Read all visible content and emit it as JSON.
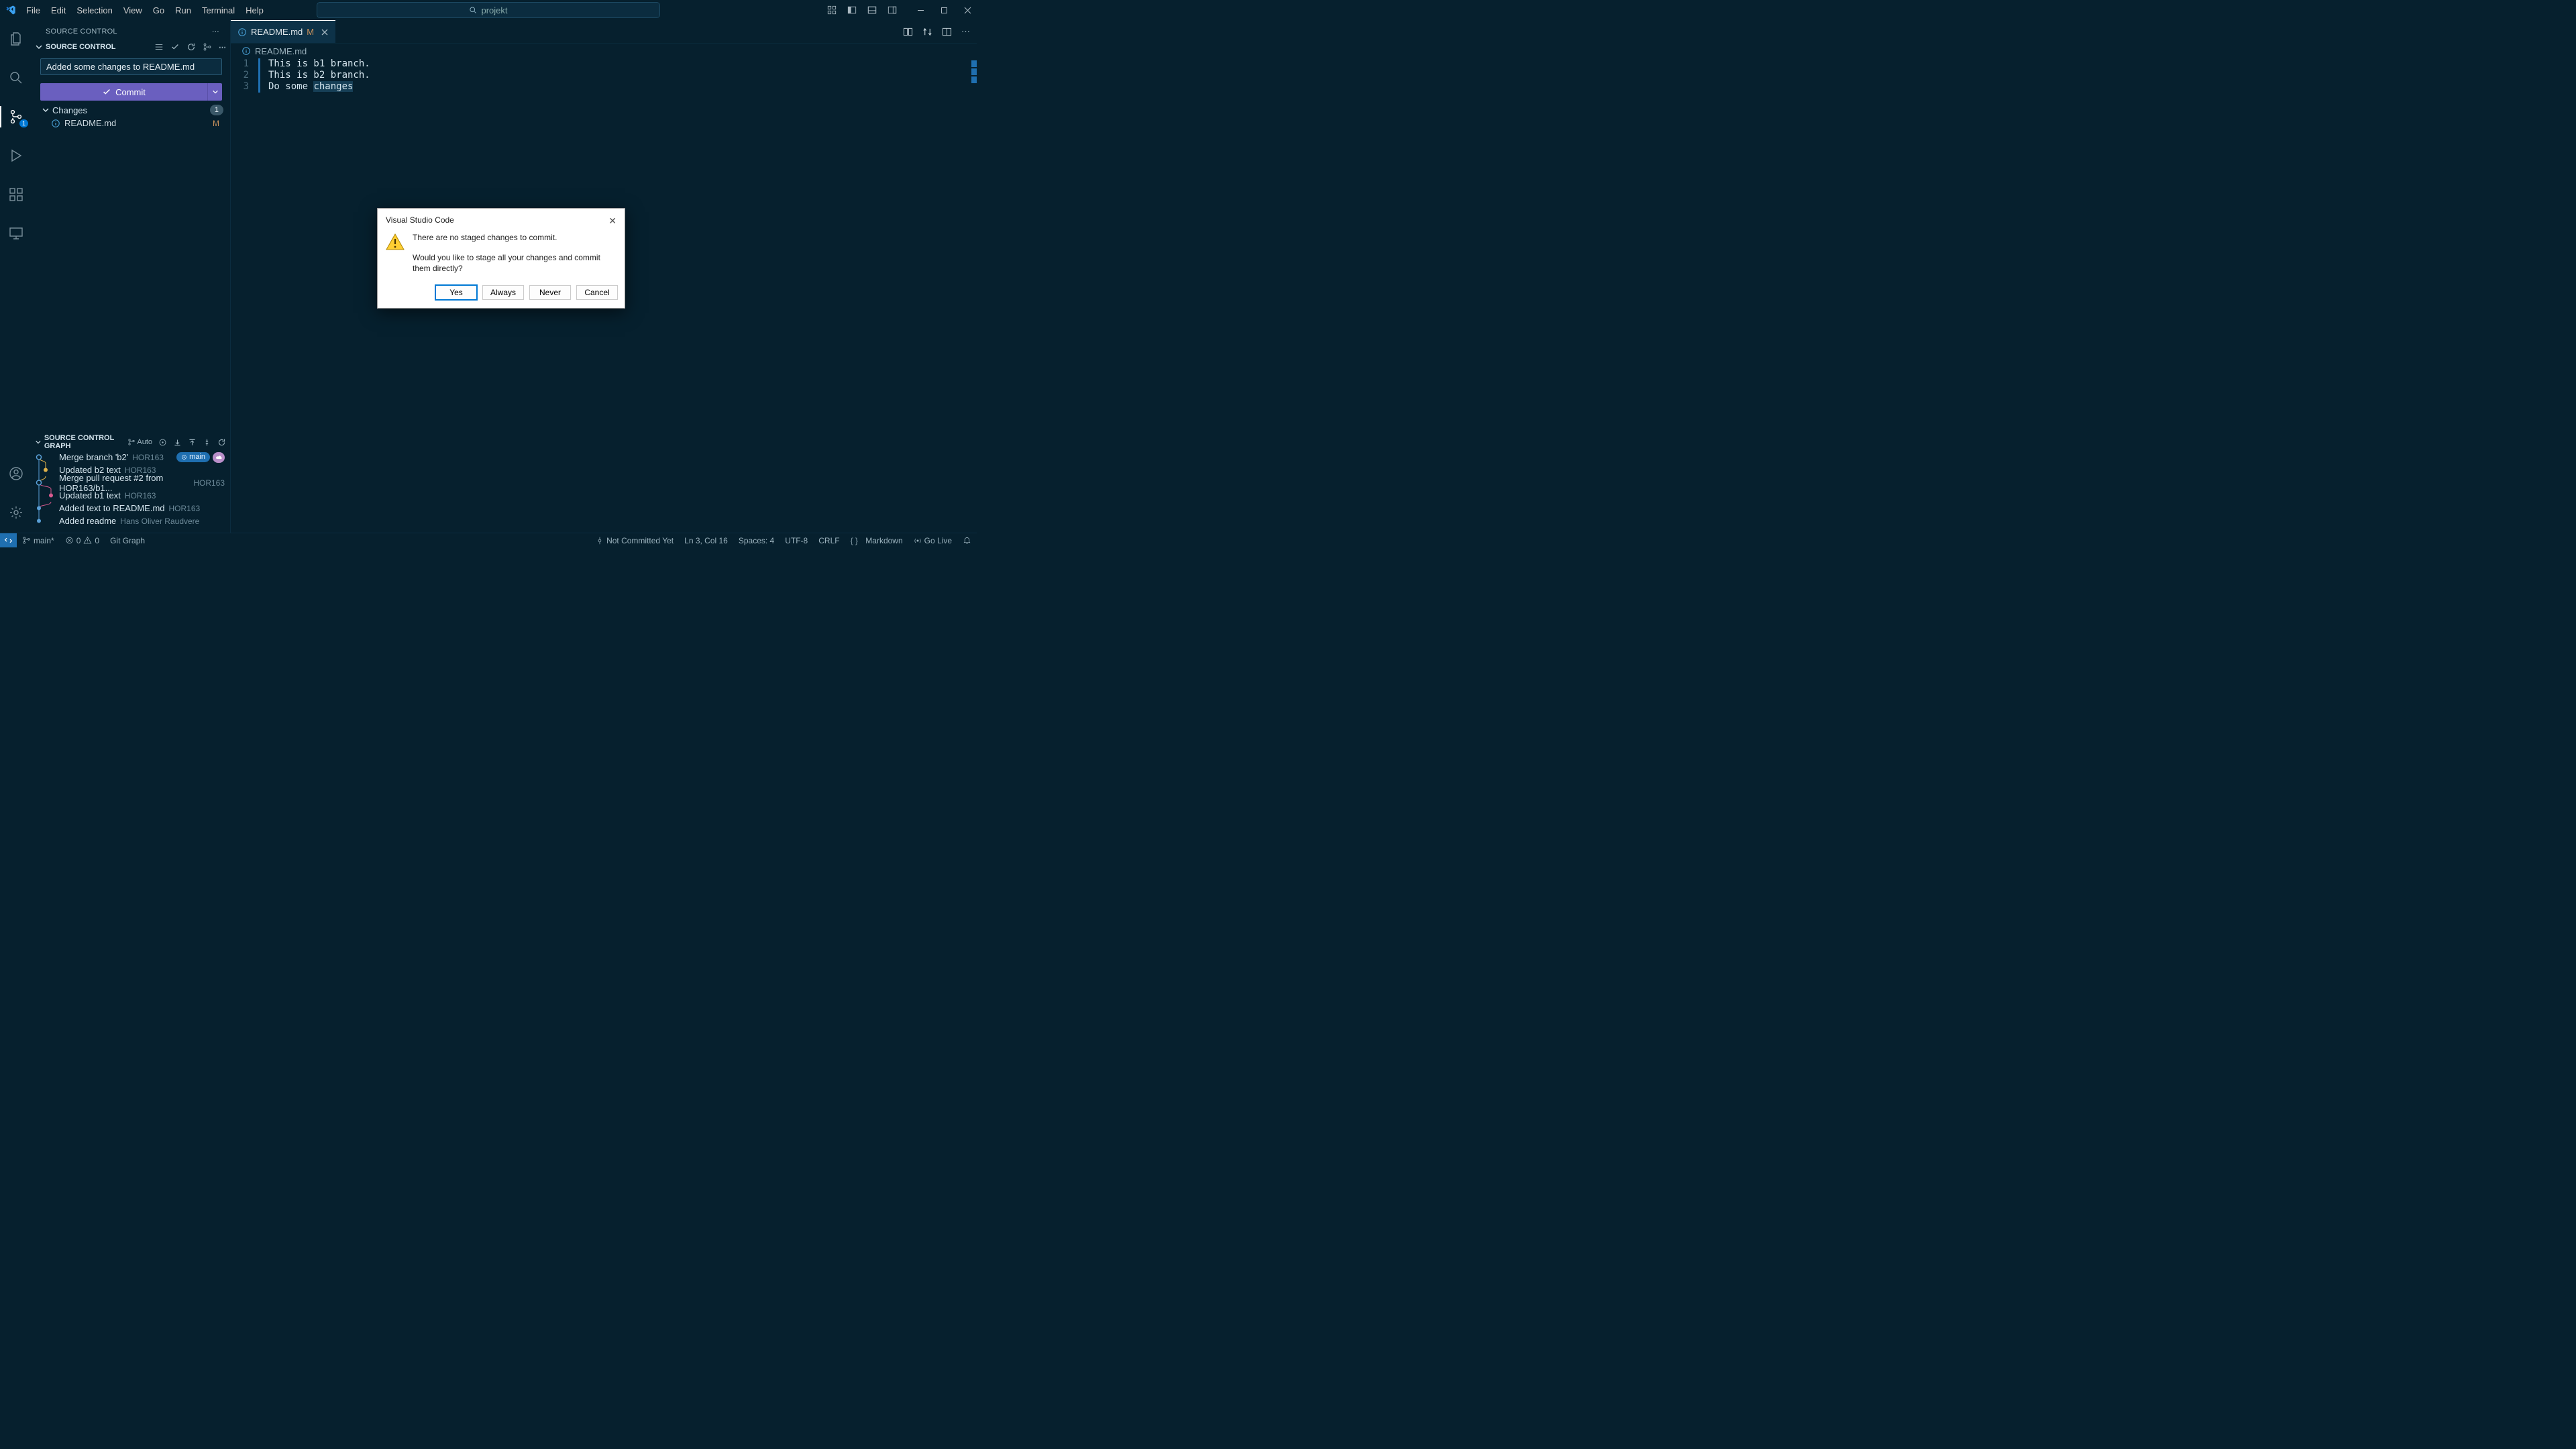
{
  "menu": {
    "file": "File",
    "edit": "Edit",
    "selection": "Selection",
    "view": "View",
    "go": "Go",
    "run": "Run",
    "terminal": "Terminal",
    "help": "Help"
  },
  "search": {
    "placeholder": "projekt"
  },
  "sidebar": {
    "title": "SOURCE CONTROL",
    "section_header": "SOURCE CONTROL",
    "commit_message": "Added some changes to README.md",
    "commit_button": "Commit",
    "changes_label": "Changes",
    "changes_count": "1",
    "changed_file": {
      "name": "README.md",
      "status": "M"
    },
    "graph_header": "SOURCE CONTROL GRAPH",
    "auto_label": "Auto",
    "graph": [
      {
        "msg": "Merge branch 'b2'",
        "author": "HOR163",
        "badge_main": "main",
        "cloud": true
      },
      {
        "msg": "Updated b2 text",
        "author": "HOR163"
      },
      {
        "msg": "Merge pull request #2 from HOR163/b1...",
        "author": "HOR163"
      },
      {
        "msg": "Updated b1 text",
        "author": "HOR163"
      },
      {
        "msg": "Added text to README.md",
        "author": "HOR163"
      },
      {
        "msg": "Added readme",
        "author": "Hans Oliver Raudvere"
      }
    ]
  },
  "activity_badge": "1",
  "tab": {
    "name": "README.md",
    "status": "M"
  },
  "breadcrumb": {
    "file": "README.md"
  },
  "code": {
    "l1": "This is b1 branch.",
    "l2": "This is b2 branch.",
    "l3a": "Do some ",
    "l3b": "changes"
  },
  "line_numbers": {
    "n1": "1",
    "n2": "2",
    "n3": "3"
  },
  "status": {
    "branch": "main*",
    "errors": "0",
    "warnings": "0",
    "git_graph": "Git Graph",
    "not_committed": "Not Committed Yet",
    "position": "Ln 3, Col 16",
    "spaces": "Spaces: 4",
    "encoding": "UTF-8",
    "eol": "CRLF",
    "lang": "Markdown",
    "golive": "Go Live"
  },
  "dialog": {
    "title": "Visual Studio Code",
    "line1": "There are no staged changes to commit.",
    "line2": "Would you like to stage all your changes and commit them directly?",
    "yes": "Yes",
    "always": "Always",
    "never": "Never",
    "cancel": "Cancel"
  }
}
